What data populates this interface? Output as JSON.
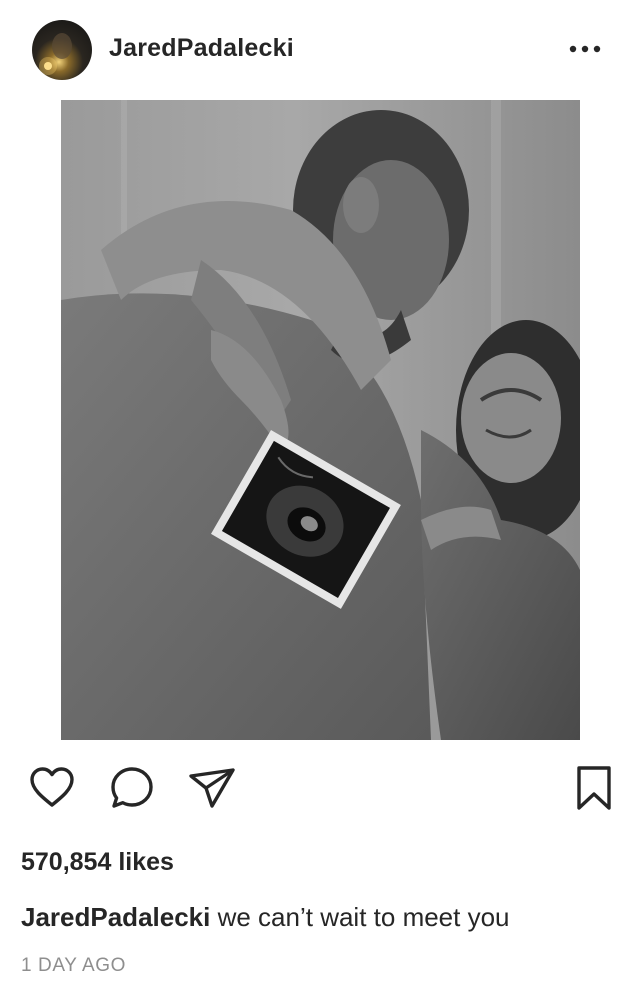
{
  "post": {
    "username": "JaredPadalecki",
    "likes": "570,854 likes",
    "caption_user": "JaredPadalecki",
    "caption_text": "we can’t wait to meet you",
    "timestamp": "1 DAY AGO"
  },
  "header": {
    "avatar_icon": "profile-avatar",
    "more_icon": "more-options-icon"
  },
  "actions": {
    "like_icon": "heart-icon",
    "comment_icon": "comment-icon",
    "share_icon": "paper-plane-icon",
    "save_icon": "bookmark-icon"
  },
  "colors": {
    "text": "#262626",
    "secondary_text": "#8e8e8e",
    "background": "#ffffff"
  }
}
